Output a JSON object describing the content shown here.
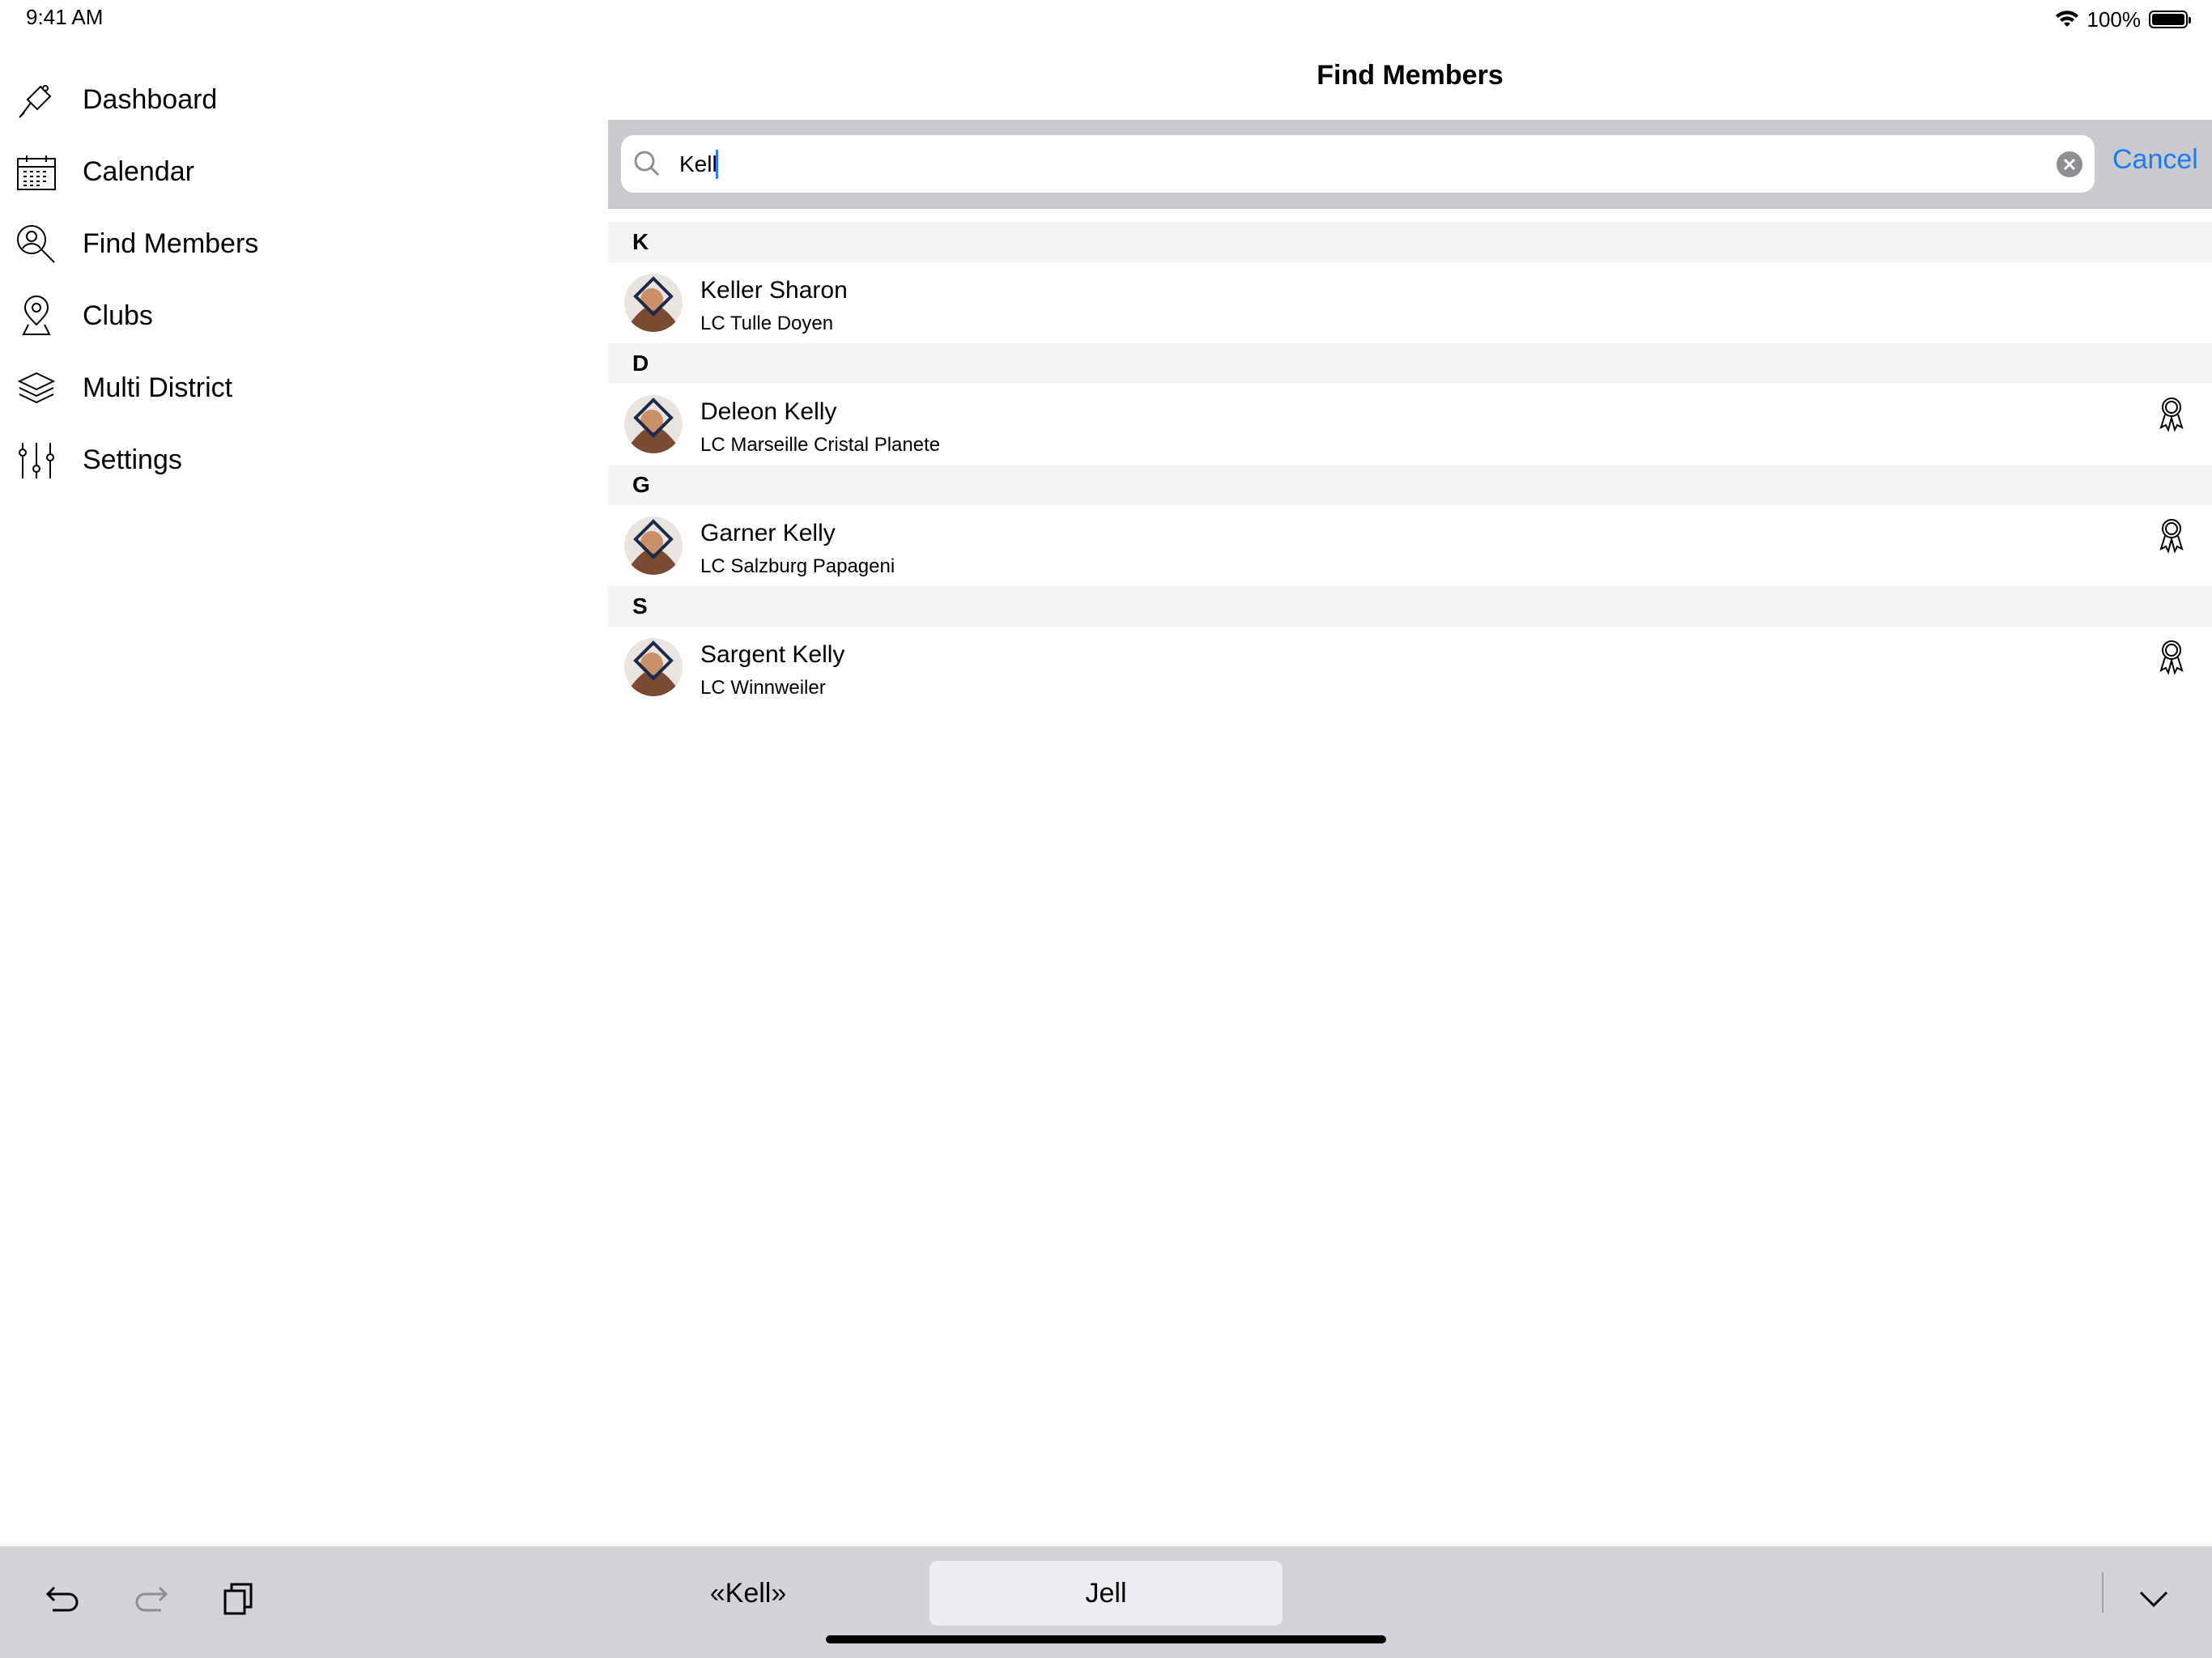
{
  "status_bar": {
    "time": "9:41 AM",
    "battery": "100%"
  },
  "sidebar": {
    "items": [
      {
        "label": "Dashboard",
        "icon": "dashboard-icon"
      },
      {
        "label": "Calendar",
        "icon": "calendar-icon"
      },
      {
        "label": "Find Members",
        "icon": "find-members-icon"
      },
      {
        "label": "Clubs",
        "icon": "location-pin-icon"
      },
      {
        "label": "Multi District",
        "icon": "layers-icon"
      },
      {
        "label": "Settings",
        "icon": "sliders-icon"
      }
    ]
  },
  "header": {
    "title": "Find Members"
  },
  "search": {
    "value": "Kell",
    "cancel_label": "Cancel"
  },
  "sections": [
    {
      "letter": "K",
      "members": [
        {
          "name": "Keller Sharon",
          "club": "LC Tulle Doyen",
          "badge": false
        }
      ]
    },
    {
      "letter": "D",
      "members": [
        {
          "name": "Deleon Kelly",
          "club": "LC Marseille Cristal Planete",
          "badge": true
        }
      ]
    },
    {
      "letter": "G",
      "members": [
        {
          "name": "Garner Kelly",
          "club": "LC Salzburg Papageni",
          "badge": true
        }
      ]
    },
    {
      "letter": "S",
      "members": [
        {
          "name": "Sargent Kelly",
          "club": "LC Winnweiler",
          "badge": true
        }
      ]
    }
  ],
  "keyboard_bar": {
    "suggestions": [
      "«Kell»",
      "Jell"
    ],
    "selected_suggestion": "Jell"
  },
  "colors": {
    "accent": "#1a7cf4",
    "search_bar_bg": "#c9c9ce",
    "section_header_bg": "#f5f5f5",
    "keyboard_bg": "#d2d4da"
  }
}
